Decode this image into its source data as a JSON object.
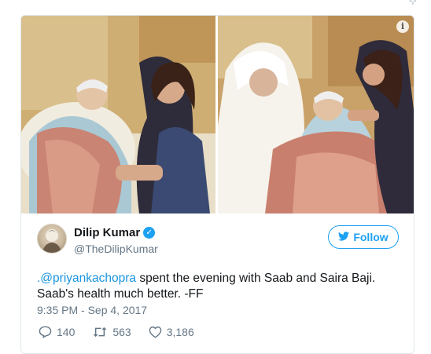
{
  "tweet": {
    "author": {
      "display_name": "Dilip Kumar",
      "handle": "@TheDilipKumar",
      "verified_icon": "verified-badge-icon"
    },
    "follow_label": "Follow",
    "text_mention": ".@priyankachopra",
    "text_body": " spent the evening with Saab and Saira Baji. Saab's health much better. -FF",
    "timestamp": "9:35 PM - Sep 4, 2017",
    "stats": {
      "replies": "140",
      "retweets": "563",
      "likes": "3,186"
    },
    "colors": {
      "accent": "#1da1f2",
      "text": "#14171a",
      "muted": "#657786",
      "border": "#e1e8ed"
    }
  }
}
